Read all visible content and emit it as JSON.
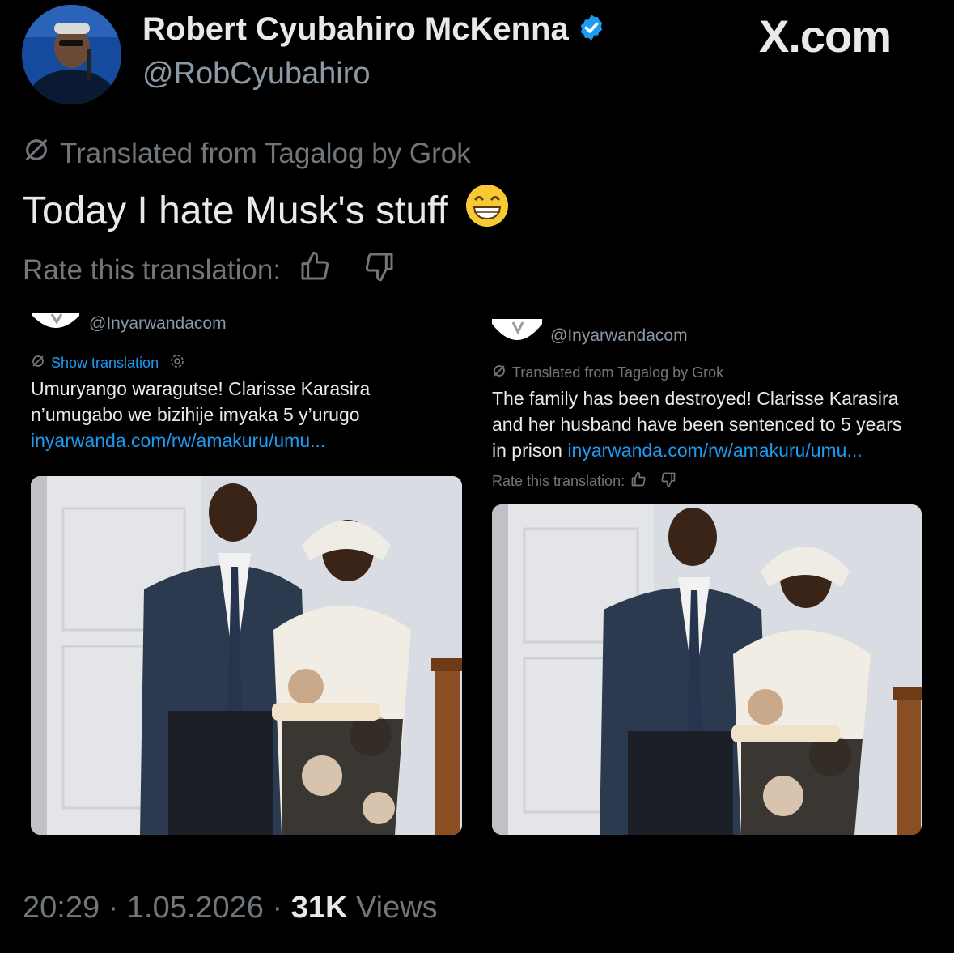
{
  "author": {
    "name": "Robert Cyubahiro McKenna",
    "handle": "@RobCyubahiro",
    "verified_color": "#1d9bf0"
  },
  "brand": "X.com",
  "translation": {
    "label": "Translated from Tagalog by Grok"
  },
  "tweet": {
    "text": "Today I hate Musk's stuff",
    "emoji": "😁"
  },
  "rating": {
    "label": "Rate this translation:"
  },
  "left_card": {
    "handle": "@Inyarwandacom",
    "show_translation": "Show translation",
    "text_line1": "Umuryango waragutse! Clarisse Karasira",
    "text_line2": "n’umugabo we bizihije imyaka 5 y’urugo",
    "link": "inyarwanda.com/rw/amakuru/umu..."
  },
  "right_card": {
    "handle": "@Inyarwandacom",
    "translated_label": "Translated from Tagalog by Grok",
    "text_line1": "The family has been destroyed! Clarisse Karasira",
    "text_line2": "and her husband have been sentenced to 5 years",
    "text_line3": "in prison",
    "link": "inyarwanda.com/rw/amakuru/umu...",
    "rate_label": "Rate this translation:"
  },
  "footer": {
    "time": "20:29",
    "date": "1.05.2026",
    "views_count": "31K",
    "views_label": "Views"
  },
  "colors": {
    "background": "#000000",
    "accent": "#1d9bf0",
    "muted": "#71767b"
  }
}
